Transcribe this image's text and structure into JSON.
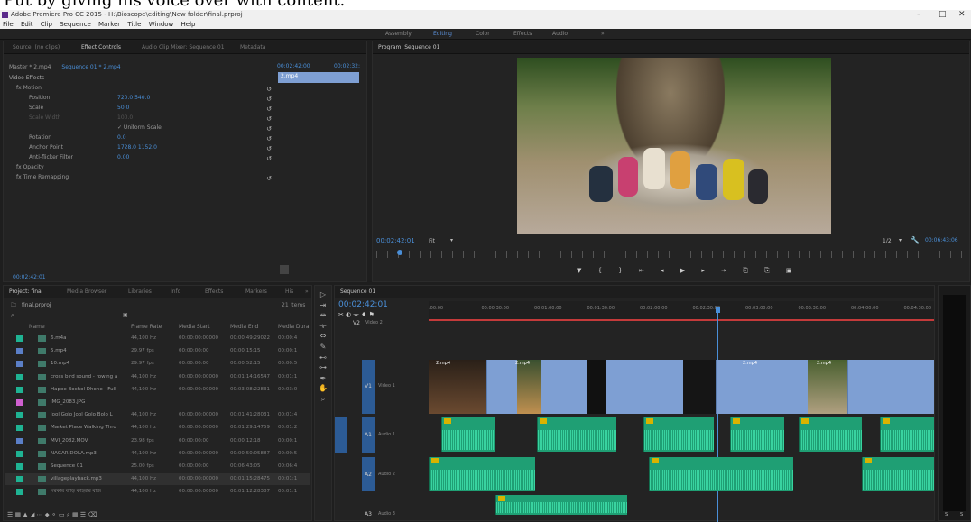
{
  "caption": "Put by giving his voice over with content.",
  "window": {
    "title": "Adobe Premiere Pro CC 2015 - H:\\Bioscope\\editing\\New folder\\final.prproj",
    "controls": [
      "–",
      "□",
      "✕"
    ]
  },
  "menu": [
    "File",
    "Edit",
    "Clip",
    "Sequence",
    "Marker",
    "Title",
    "Window",
    "Help"
  ],
  "workspaces": [
    "Assembly",
    "Editing",
    "Color",
    "Effects",
    "Audio",
    "»"
  ],
  "workspace_active": "Editing",
  "source_panel": {
    "tabs": [
      "Source: (no clips)",
      "Effect Controls",
      "Audio Clip Mixer: Sequence 01",
      "Metadata"
    ],
    "master": "Master * 2.mp4",
    "seq": "Sequence 01 * 2.mp4",
    "tc_start": "00:02:42:00",
    "tc_end": "00:02:32:",
    "clip_label": "2.mp4",
    "section": "Video Effects",
    "rows": [
      {
        "name": "fx  Motion",
        "value": ""
      },
      {
        "name": "Position",
        "value": "720.0   540.0"
      },
      {
        "name": "Scale",
        "value": "50.0"
      },
      {
        "name": "Scale Width",
        "value": "100.0"
      },
      {
        "name": "",
        "value": "✓ Uniform Scale"
      },
      {
        "name": "Rotation",
        "value": "0.0"
      },
      {
        "name": "Anchor Point",
        "value": "1728.0   1152.0"
      },
      {
        "name": "Anti-flicker Filter",
        "value": "0.00"
      },
      {
        "name": "fx  Opacity",
        "value": ""
      },
      {
        "name": "fx  Time Remapping",
        "value": ""
      }
    ],
    "bottom_tc": "00:02:42:01"
  },
  "program": {
    "title": "Program: Sequence 01",
    "timecode": "00:02:42:01",
    "fit": "Fit",
    "resolution": "1/2",
    "duration": "00:06:43:06"
  },
  "project": {
    "tabs": [
      "Project: final",
      "Media Browser",
      "Libraries",
      "Info",
      "Effects",
      "Markers",
      "His",
      "»"
    ],
    "file": "final.prproj",
    "items_count": "21 Items",
    "columns": [
      "Name",
      "Frame Rate",
      "Media Start",
      "Media End",
      "Media Dura"
    ],
    "rows": [
      {
        "color": "#1fb393",
        "name": "6.m4a",
        "rate": "44,100 Hz",
        "start": "00:00:00:00000",
        "end": "00:00:49:29022",
        "dur": "00:00:4"
      },
      {
        "color": "#5b7fc7",
        "name": "5.mp4",
        "rate": "29.97 fps",
        "start": "00:00:00:00",
        "end": "00:00:15:15",
        "dur": "00:00:1"
      },
      {
        "color": "#5b7fc7",
        "name": "10.mp4",
        "rate": "29.97 fps",
        "start": "00:00:00:00",
        "end": "00:00:52:15",
        "dur": "00:00:5"
      },
      {
        "color": "#1fb393",
        "name": "cross bird sound - rowing a",
        "rate": "44,100 Hz",
        "start": "00:00:00:00000",
        "end": "00:01:14:16547",
        "dur": "00:01:1"
      },
      {
        "color": "#1fb393",
        "name": "Hapoe Bochol Dhone - Full",
        "rate": "44,100 Hz",
        "start": "00:00:00:00000",
        "end": "00:03:08:22831",
        "dur": "00:03:0"
      },
      {
        "color": "#d060d0",
        "name": "IMG_2083.JPG",
        "rate": "",
        "start": "",
        "end": "",
        "dur": ""
      },
      {
        "color": "#1fb393",
        "name": "Jool Golo Jool Golo Bolo L",
        "rate": "44,100 Hz",
        "start": "00:00:00:00000",
        "end": "00:01:41:28031",
        "dur": "00:01:4"
      },
      {
        "color": "#1fb393",
        "name": "Market Place Walking Thro",
        "rate": "44,100 Hz",
        "start": "00:00:00:00000",
        "end": "00:01:29:14759",
        "dur": "00:01:2"
      },
      {
        "color": "#5b7fc7",
        "name": "MVI_2082.MOV",
        "rate": "23.98 fps",
        "start": "00:00:00:00",
        "end": "00:00:12:18",
        "dur": "00:00:1"
      },
      {
        "color": "#1fb393",
        "name": "NAGAR DOLA.mp3",
        "rate": "44,100 Hz",
        "start": "00:00:00:00000",
        "end": "00:00:50:05887",
        "dur": "00:00:5"
      },
      {
        "color": "#1fb393",
        "name": "Sequence 01",
        "rate": "25.00 fps",
        "start": "00:00:00:00",
        "end": "00:06:43:05",
        "dur": "00:06:4"
      },
      {
        "color": "#1fb393",
        "name": "villageplayback.mp3",
        "rate": "44,100 Hz",
        "start": "00:00:00:00000",
        "end": "00:01:15:28475",
        "dur": "00:01:1"
      },
      {
        "color": "#1fb393",
        "name": "সরকার বাড়ি কাহরার বাজ",
        "rate": "44,100 Hz",
        "start": "00:00:00:00000",
        "end": "00:01:12:28387",
        "dur": "00:01:1"
      }
    ]
  },
  "timeline": {
    "tab": "Sequence 01",
    "timecode": "00:02:42:01",
    "ruler": [
      ":00:00",
      "00:00:30:00",
      "00:01:00:00",
      "00:01:30:00",
      "00:02:00:00",
      "00:02:30:00",
      "00:03:00:00",
      "00:03:30:00",
      "00:04:00:00",
      "00:04:30:00"
    ],
    "tracks": [
      {
        "id": "V2",
        "name": "Video 2"
      },
      {
        "id": "V1",
        "name": "Video 1"
      },
      {
        "id": "A1",
        "name": "Audio 1"
      },
      {
        "id": "A2",
        "name": "Audio 2"
      },
      {
        "id": "A3",
        "name": "Audio 3"
      }
    ],
    "clip_labels": [
      "2.mp4",
      "2.mp4",
      "2.mp4",
      "2.mp4"
    ],
    "meter_scale": [
      "S",
      "S"
    ]
  }
}
